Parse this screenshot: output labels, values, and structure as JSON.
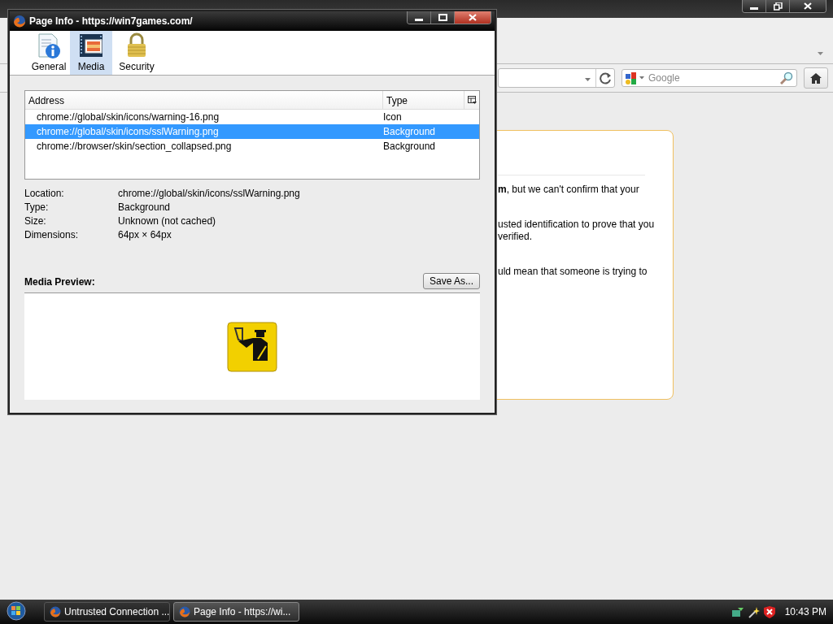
{
  "browser_window": {
    "search_field": {
      "placeholder": "Google"
    },
    "page_card": {
      "paragraphs": [
        "**m**, but we can't confirm that your",
        "usted identification to prove that you\nverified.",
        "uld mean that someone is trying to"
      ]
    }
  },
  "page_info_dialog": {
    "title": "Page Info - https://win7games.com/",
    "tabs": [
      {
        "label": "General",
        "kind": "general",
        "selected": false
      },
      {
        "label": "Media",
        "kind": "media",
        "selected": true
      },
      {
        "label": "Security",
        "kind": "security",
        "selected": false
      }
    ],
    "media_table": {
      "columns": [
        "Address",
        "Type"
      ],
      "rows": [
        {
          "address": "chrome://global/skin/icons/warning-16.png",
          "type": "Icon",
          "selected": false
        },
        {
          "address": "chrome://global/skin/icons/sslWarning.png",
          "type": "Background",
          "selected": true
        },
        {
          "address": "chrome://browser/skin/section_collapsed.png",
          "type": "Background",
          "selected": false
        }
      ]
    },
    "details": [
      {
        "label": "Location:",
        "value": "chrome://global/skin/icons/sslWarning.png"
      },
      {
        "label": "Type:",
        "value": "Background"
      },
      {
        "label": "Size:",
        "value": "Unknown (not cached)"
      },
      {
        "label": "Dimensions:",
        "value": "64px × 64px"
      }
    ],
    "save_button": "Save As...",
    "preview_heading": "Media Preview:"
  },
  "taskbar": {
    "tasks": [
      {
        "label": "Untrusted Connection ...",
        "selected": false
      },
      {
        "label": "Page Info - https://wi...",
        "selected": true
      }
    ],
    "clock": "10:43 PM"
  }
}
